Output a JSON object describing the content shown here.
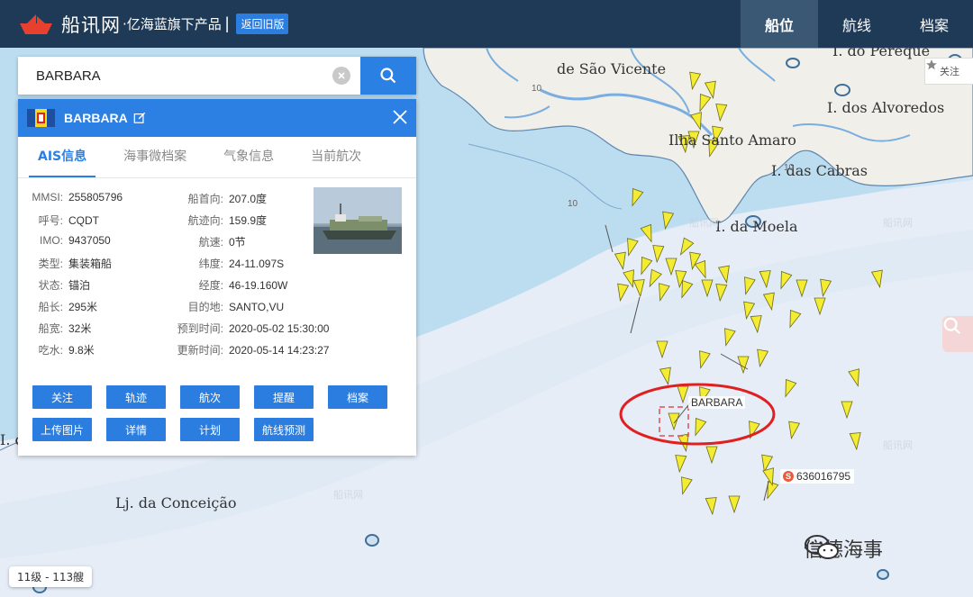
{
  "header": {
    "logo_text": "船讯网",
    "logo_sub": "·亿海蓝旗下产品",
    "separator": "|",
    "old_version": "返回旧版",
    "nav": [
      {
        "label": "船位",
        "active": true
      },
      {
        "label": "航线",
        "active": false
      },
      {
        "label": "档案",
        "active": false
      }
    ]
  },
  "search": {
    "value": "BARBARA",
    "placeholder": ""
  },
  "panel": {
    "vessel_name": "BARBARA",
    "tabs": [
      {
        "label": "AIS信息",
        "active": true
      },
      {
        "label": "海事微档案",
        "active": false
      },
      {
        "label": "气象信息",
        "active": false
      },
      {
        "label": "当前航次",
        "active": false
      }
    ],
    "left_fields": [
      {
        "key": "MMSI:",
        "value": "255805796"
      },
      {
        "key": "呼号:",
        "value": "CQDT"
      },
      {
        "key": "IMO:",
        "value": "9437050"
      },
      {
        "key": "类型:",
        "value": "集装箱船"
      },
      {
        "key": "状态:",
        "value": "锚泊"
      },
      {
        "key": "船长:",
        "value": "295米"
      },
      {
        "key": "船宽:",
        "value": "32米"
      },
      {
        "key": "吃水:",
        "value": "9.8米"
      }
    ],
    "right_fields": [
      {
        "key": "船首向:",
        "value": "207.0度"
      },
      {
        "key": "航迹向:",
        "value": "159.9度"
      },
      {
        "key": "航速:",
        "value": "0节"
      },
      {
        "key": "纬度:",
        "value": "24-11.097S"
      },
      {
        "key": "经度:",
        "value": "46-19.160W"
      },
      {
        "key": "目的地:",
        "value": "SANTO,VU"
      },
      {
        "key": "预到时间:",
        "value": "2020-05-02 15:30:00"
      },
      {
        "key": "更新时间:",
        "value": "2020-05-14 14:23:27"
      }
    ],
    "buttons": [
      "关注",
      "轨迹",
      "航次",
      "提醒",
      "档案",
      "上传图片",
      "详情",
      "计划",
      "航线预测"
    ]
  },
  "map": {
    "places": [
      "I. do Pereque",
      "de São Vicente",
      "I. dos Alvoredos",
      "Ilha Santo Amaro",
      "I. das Cabras",
      "I. da Moela",
      "Lj. da Conceição"
    ],
    "depths": [
      "10",
      "10",
      "10"
    ],
    "watermark": "船讯网",
    "vessel_label": "BARBARA",
    "mmsi_label": "636016795",
    "mmsi_badge": "S",
    "follow_label": "关注",
    "scale_label": "11级 - 113艘",
    "brand": "信德海事",
    "left_edge_text": "I. d"
  },
  "colors": {
    "topbar": "#1f3a56",
    "accent": "#2c80e4",
    "ship": "#f3ec33",
    "land": "#f0efea",
    "shallow": "#b9daf0",
    "deep": "#e6edf6",
    "highlight": "#e02020"
  }
}
